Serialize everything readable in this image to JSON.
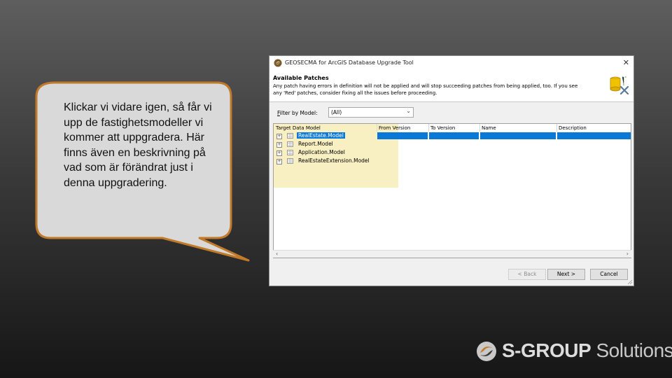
{
  "callout": {
    "text": "Klickar vi vidare igen, så får vi upp de fastighetsmodeller vi kommer att uppgradera. Här finns även en beskrivning på vad som är förändrat just i denna uppgradering."
  },
  "dialog": {
    "title": "GEOSECMA for ArcGIS Database Upgrade Tool",
    "header_title": "Available Patches",
    "header_description": "Any patch having errors in definition will not be applied and will stop succeeding patches from being applied, too. If you see any 'Red' patches, consider fixing all the issues before proceeding.",
    "filter": {
      "label_prefix": "F",
      "label_rest": "ilter by Model:",
      "value": "(All)"
    },
    "columns": [
      "Target Data Model",
      "From Version",
      "To Version",
      "Name",
      "Description"
    ],
    "models": [
      "RealEstate.Model",
      "Report.Model",
      "Application.Model",
      "RealEstateExtension.Model"
    ],
    "buttons": {
      "back": "< Back",
      "next": "Next >",
      "cancel": "Cancel"
    },
    "close_symbol": "✕",
    "colors": {
      "selection": "#0a78d7",
      "highlight": "#f8efc2"
    }
  },
  "brand": {
    "strong": "S-GROUP",
    "light": " Solutions",
    "color": "#c8c8c8"
  }
}
